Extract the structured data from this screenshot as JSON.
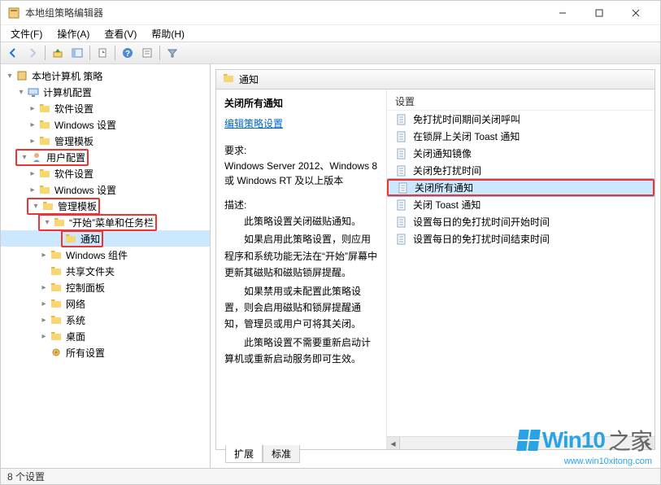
{
  "window": {
    "title": "本地组策略编辑器"
  },
  "menu": {
    "file": "文件(F)",
    "action": "操作(A)",
    "view": "查看(V)",
    "help": "帮助(H)"
  },
  "tree": {
    "root": "本地计算机 策略",
    "computer": "计算机配置",
    "comp_software": "软件设置",
    "comp_windows": "Windows 设置",
    "comp_admin": "管理模板",
    "user": "用户配置",
    "user_software": "软件设置",
    "user_windows": "Windows 设置",
    "user_admin": "管理模板",
    "start_taskbar": "“开始”菜单和任务栏",
    "notifications": "通知",
    "windows_components": "Windows 组件",
    "shared_folders": "共享文件夹",
    "control_panel": "控制面板",
    "network": "网络",
    "system": "系统",
    "desktop": "桌面",
    "all_settings": "所有设置"
  },
  "pane": {
    "title": "通知",
    "detail_title": "关闭所有通知",
    "edit_link": "编辑策略设置",
    "requirements_label": "要求:",
    "requirements_text": "Windows Server 2012、Windows 8 或 Windows RT 及以上版本",
    "description_label": "描述:",
    "description_paragraphs": [
      "此策略设置关闭磁贴通知。",
      "如果启用此策略设置，则应用程序和系统功能无法在“开始”屏幕中更新其磁贴和磁贴锁屏提醒。",
      "如果禁用或未配置此策略设置，则会启用磁贴和锁屏提醒通知，管理员或用户可将其关闭。",
      "此策略设置不需要重新启动计算机或重新启动服务即可生效。"
    ]
  },
  "list": {
    "column_header": "设置",
    "items": [
      "免打扰时间期间关闭呼叫",
      "在锁屏上关闭 Toast 通知",
      "关闭通知镜像",
      "关闭免打扰时间",
      "关闭所有通知",
      "关闭 Toast 通知",
      "设置每日的免打扰时间开始时间",
      "设置每日的免打扰时间结束时间"
    ],
    "selected_index": 4
  },
  "tabs": {
    "extended": "扩展",
    "standard": "标准"
  },
  "statusbar": {
    "text": "8 个设置"
  },
  "watermark": {
    "brand": "Win10",
    "suffix": "之家",
    "url": "www.win10xitong.com"
  }
}
